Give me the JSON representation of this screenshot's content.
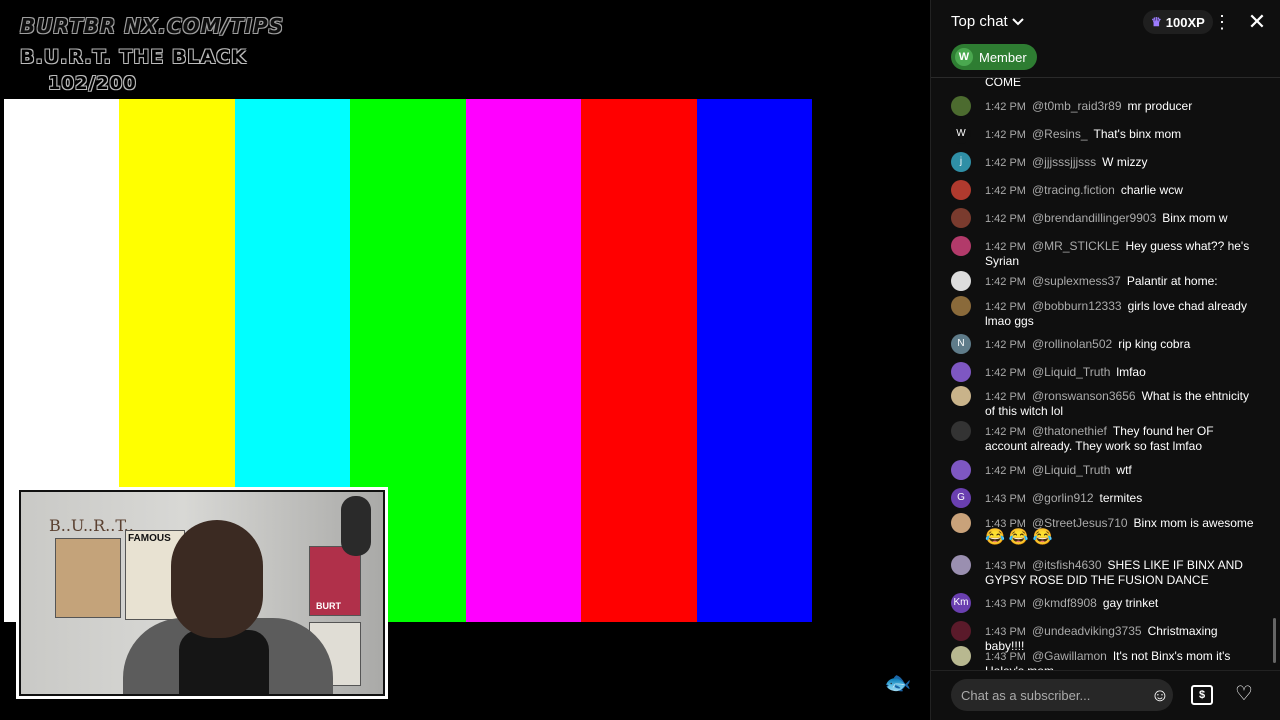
{
  "stream": {
    "overlay_line1": "BURTBR   NX.COM/TIPS",
    "overlay_line2": "B.U.R.T. THE BLACK",
    "overlay_line3": "102/200",
    "color_bars": [
      "#ffffff",
      "#ffff00",
      "#00ffff",
      "#00ff00",
      "#ff00ff",
      "#ff0000",
      "#0000ff"
    ],
    "webcam_sign": "B..U..R..T..",
    "webcam_poster": "FAMOUS",
    "webcam_poster2": "BURT"
  },
  "chat": {
    "title": "Top chat",
    "xp": "100XP",
    "member_chip": {
      "initial": "W",
      "label": "Member"
    },
    "partial_top": "COME",
    "messages": [
      {
        "avatar": "",
        "avatar_color": "#4c6b2f",
        "time": "1:42 PM",
        "author": "@t0mb_raid3r89",
        "text": "mr producer"
      },
      {
        "avatar": "W",
        "avatar_color": "#0f0f0f",
        "time": "1:42 PM",
        "author": "@Resins_",
        "text": "That's binx mom"
      },
      {
        "avatar": "j",
        "avatar_color": "#2f8fa6",
        "time": "1:42 PM",
        "author": "@jjjsssjjjsss",
        "text": "W mizzy"
      },
      {
        "avatar": "",
        "avatar_color": "#b03a2e",
        "time": "1:42 PM",
        "author": "@tracing.fiction",
        "text": "charlie wcw"
      },
      {
        "avatar": "",
        "avatar_color": "#7a3b2e",
        "time": "1:42 PM",
        "author": "@brendandillinger9903",
        "text": "Binx mom w"
      },
      {
        "avatar": "",
        "avatar_color": "#b23a6a",
        "time": "1:42 PM",
        "author": "@MR_STICKLE",
        "text": "Hey guess what?? he's Syrian"
      },
      {
        "avatar": "",
        "avatar_color": "#dddddd",
        "time": "1:42 PM",
        "author": "@suplexmess37",
        "text": "Palantir at home:"
      },
      {
        "avatar": "",
        "avatar_color": "#8a6a3a",
        "time": "1:42 PM",
        "author": "@bobburn12333",
        "text": "girls love chad already lmao ggs"
      },
      {
        "avatar": "N",
        "avatar_color": "#5f7c8a",
        "time": "1:42 PM",
        "author": "@rollinolan502",
        "text": "rip king cobra"
      },
      {
        "avatar": "",
        "avatar_color": "#7e57c2",
        "time": "1:42 PM",
        "author": "@Liquid_Truth",
        "text": "lmfao"
      },
      {
        "avatar": "",
        "avatar_color": "#c9b38a",
        "time": "1:42 PM",
        "author": "@ronswanson3656",
        "text": "What is the ehtnicity of this witch lol"
      },
      {
        "avatar": "",
        "avatar_color": "#333333",
        "time": "1:42 PM",
        "author": "@thatonethief",
        "text": "They found her OF account already. They work so fast lmfao"
      },
      {
        "avatar": "",
        "avatar_color": "#7e57c2",
        "time": "1:42 PM",
        "author": "@Liquid_Truth",
        "text": "wtf"
      },
      {
        "avatar": "G",
        "avatar_color": "#6a3fb0",
        "time": "1:43 PM",
        "author": "@gorlin912",
        "text": "termites"
      },
      {
        "avatar": "",
        "avatar_color": "#c9a27a",
        "time": "1:43 PM",
        "author": "@StreetJesus710",
        "text": "Binx mom is awesome",
        "emoji": "😂😂😂"
      },
      {
        "avatar": "",
        "avatar_color": "#9a8fb0",
        "time": "1:43 PM",
        "author": "@itsfish4630",
        "text": "SHES LIKE IF BINX AND GYPSY ROSE DID THE FUSION DANCE"
      },
      {
        "avatar": "Km",
        "avatar_color": "#6a3fb0",
        "time": "1:43 PM",
        "author": "@kmdf8908",
        "text": "gay trinket"
      },
      {
        "avatar": "",
        "avatar_color": "#5a1a2a",
        "time": "1:43 PM",
        "author": "@undeadviking3735",
        "text": "Christmaxing baby!!!!"
      },
      {
        "avatar": "",
        "avatar_color": "#b8b890",
        "time": "1:43 PM",
        "author": "@Gawillamon",
        "text": "It's not Binx's mom it's Haley's mom"
      }
    ],
    "input_placeholder": "Chat as a subscriber..."
  }
}
